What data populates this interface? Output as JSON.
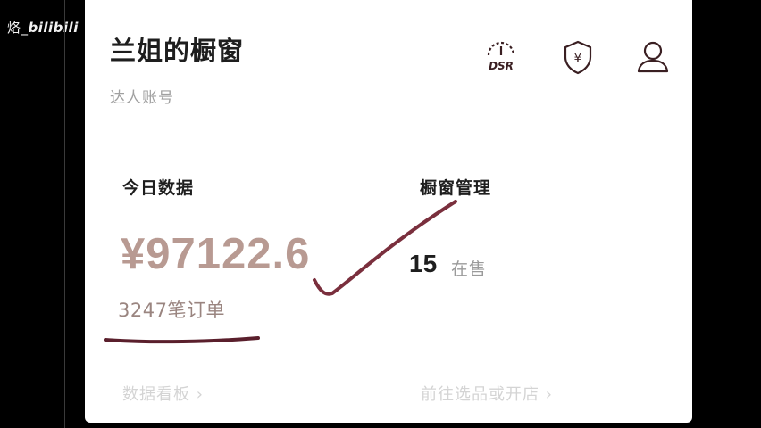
{
  "watermark": {
    "prefix": "烙_",
    "brand": "bilibili"
  },
  "header": {
    "title": "兰姐的橱窗",
    "subtitle": "达人账号",
    "icons": {
      "dsr_label": "DSR",
      "shield_icon": "shield-yen-icon",
      "user_icon": "user-icon"
    }
  },
  "today_data": {
    "label": "今日数据",
    "amount": "¥97122.6",
    "orders": "3247笔订单",
    "link": "数据看板 ›"
  },
  "window_manage": {
    "label": "橱窗管理",
    "count": "15",
    "count_label": "在售",
    "link": "前往选品或开店 ›"
  },
  "colors": {
    "amount": "#b89a92",
    "annotation_stroke": "#7a2f3d"
  }
}
